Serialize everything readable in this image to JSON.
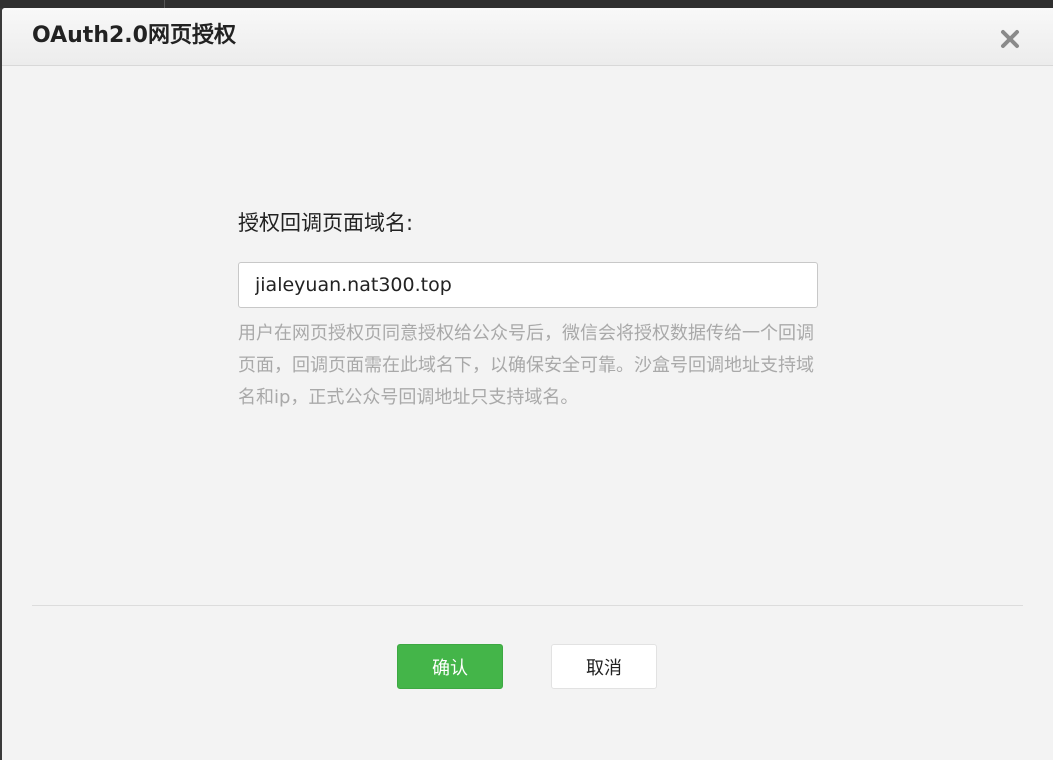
{
  "dialog": {
    "title": "OAuth2.0网页授权",
    "close_icon": "close-icon"
  },
  "form": {
    "label": "授权回调页面域名:",
    "domain_value": "jialeyuan.nat300.top",
    "help_text": "用户在网页授权页同意授权给公众号后，微信会将授权数据传给一个回调页面，回调页面需在此域名下，以确保安全可靠。沙盒号回调地址支持域名和ip，正式公众号回调地址只支持域名。"
  },
  "actions": {
    "confirm_label": "确认",
    "cancel_label": "取消"
  },
  "colors": {
    "confirm_bg": "#44b549",
    "help_text": "#a9a9a9",
    "dialog_bg": "#f3f3f3"
  }
}
